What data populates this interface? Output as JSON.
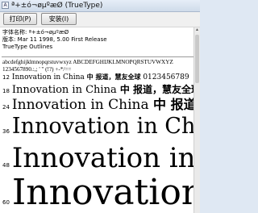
{
  "window": {
    "title": "ª+±ó¬øµºæØ (TrueType)",
    "app_icon": "font-viewer-icon"
  },
  "toolbar": {
    "print_label": "打印(P)",
    "install_label": "安装(I)"
  },
  "info": {
    "font_name": "字体名称: ª+±ó¬øµºæØ",
    "version": "版本: Mar 11 1998, 5.00 First Release",
    "type": "TrueType Outlines"
  },
  "charset": {
    "line1": "abcdefghijklmnopqrstuvwxyz ABCDEFGHIJKLMNOPQRSTUVWXYZ",
    "line2": "1234567890.:,; ' \" (!?) +-*/=="
  },
  "samples": [
    {
      "size": "12",
      "latin": "Innovation in China",
      "zh": "中 报道，慧友全球",
      "digits": "0123456789"
    },
    {
      "size": "18",
      "latin": "Innovation in China",
      "zh": "中 报道，慧友全球（"
    },
    {
      "size": "24",
      "latin": "Innovation in China",
      "zh": "中 报道，"
    },
    {
      "size": "36",
      "latin": "Innovation in China",
      "zh": ""
    },
    {
      "size": "48",
      "latin": "Innovation in C",
      "zh": ""
    },
    {
      "size": "60",
      "latin": "Innovation",
      "zh": ""
    }
  ],
  "colors": {
    "titlebar": "#cfdbea",
    "toolbar": "#f0f0f0",
    "content": "#ffffff"
  }
}
